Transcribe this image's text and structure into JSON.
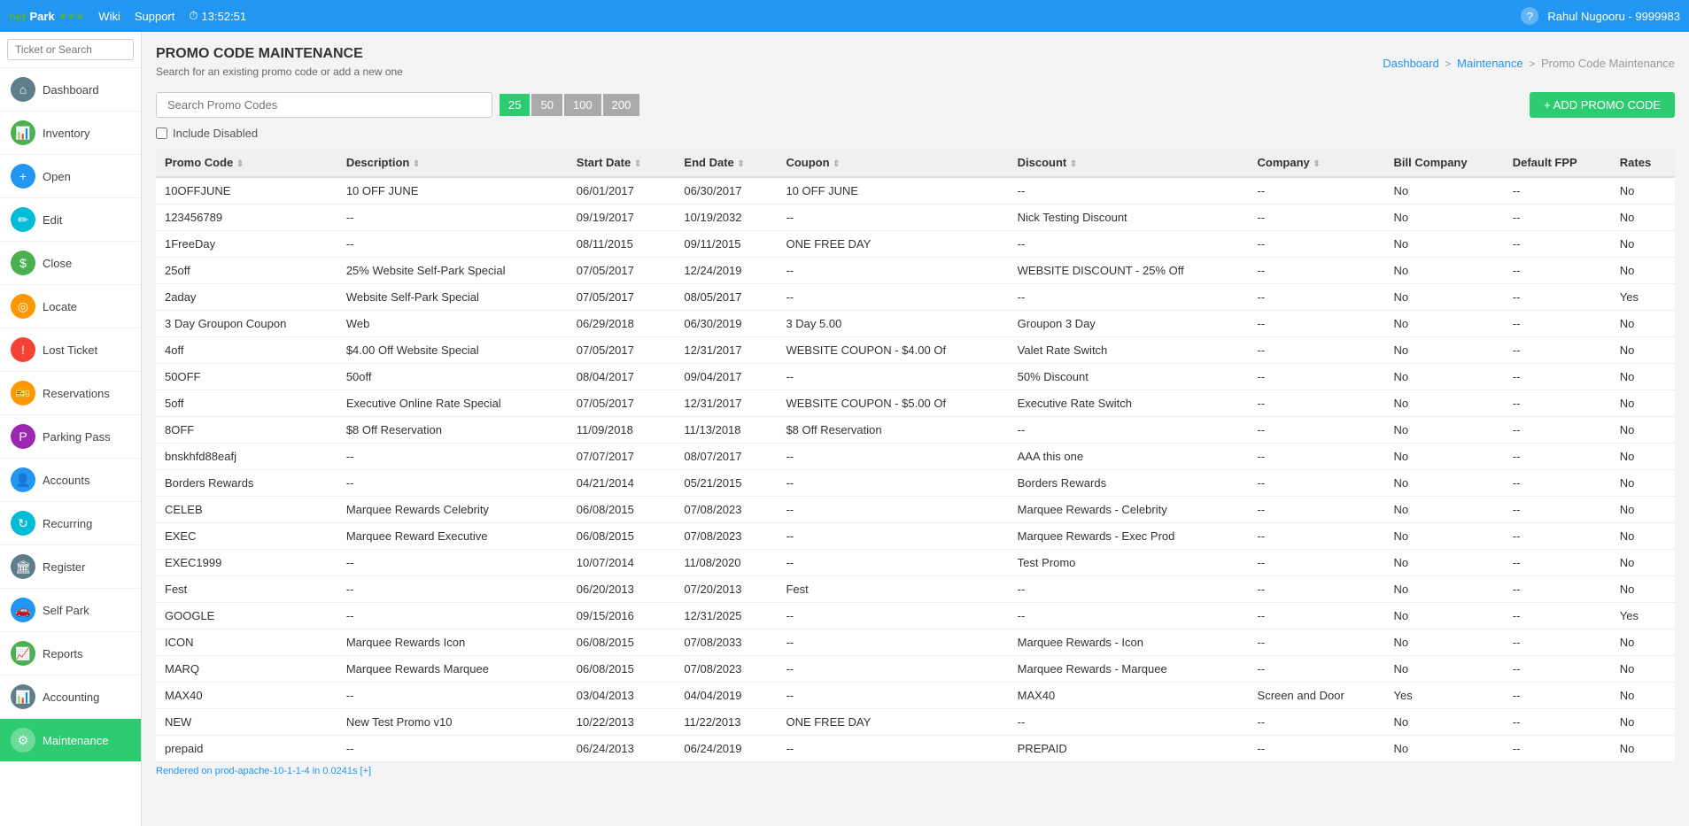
{
  "topbar": {
    "logo_net": "net",
    "logo_park": "Park",
    "wiki": "Wiki",
    "support": "Support",
    "clock": "13:52:51",
    "help": "?",
    "user": "Rahul Nugooru - 9999983"
  },
  "sidebar": {
    "search_placeholder": "Ticket or Search",
    "items": [
      {
        "id": "dashboard",
        "label": "Dashboard",
        "icon": "⌂",
        "icon_class": "icon-home",
        "active": false
      },
      {
        "id": "inventory",
        "label": "Inventory",
        "icon": "📊",
        "icon_class": "icon-chart",
        "active": false
      },
      {
        "id": "open",
        "label": "Open",
        "icon": "+",
        "icon_class": "icon-plus",
        "active": false
      },
      {
        "id": "edit",
        "label": "Edit",
        "icon": "✎",
        "icon_class": "icon-edit",
        "active": false
      },
      {
        "id": "close",
        "label": "Close",
        "icon": "$",
        "icon_class": "icon-dollar",
        "active": false
      },
      {
        "id": "locate",
        "label": "Locate",
        "icon": "◎",
        "icon_class": "icon-locate",
        "active": false
      },
      {
        "id": "lost-ticket",
        "label": "Lost Ticket",
        "icon": "!",
        "icon_class": "icon-warning",
        "active": false
      },
      {
        "id": "reservations",
        "label": "Reservations",
        "icon": "🎫",
        "icon_class": "icon-ticket",
        "active": false
      },
      {
        "id": "parking-pass",
        "label": "Parking Pass",
        "icon": "P",
        "icon_class": "icon-parking",
        "active": false
      },
      {
        "id": "accounts",
        "label": "Accounts",
        "icon": "👤",
        "icon_class": "icon-accounts",
        "active": false
      },
      {
        "id": "recurring",
        "label": "Recurring",
        "icon": "↻",
        "icon_class": "icon-recurring",
        "active": false
      },
      {
        "id": "register",
        "label": "Register",
        "icon": "🏛",
        "icon_class": "icon-register",
        "active": false
      },
      {
        "id": "self-park",
        "label": "Self Park",
        "icon": "🚗",
        "icon_class": "icon-selfpark",
        "active": false
      },
      {
        "id": "reports",
        "label": "Reports",
        "icon": "📈",
        "icon_class": "icon-reports",
        "active": false
      },
      {
        "id": "accounting",
        "label": "Accounting",
        "icon": "📊",
        "icon_class": "icon-accounting",
        "active": false
      },
      {
        "id": "maintenance",
        "label": "Maintenance",
        "icon": "⚙",
        "icon_class": "icon-maintenance",
        "active": true
      }
    ]
  },
  "page": {
    "title": "PROMO CODE MAINTENANCE",
    "subtitle": "Search for an existing promo code or add a new one",
    "breadcrumb_dashboard": "Dashboard",
    "breadcrumb_maintenance": "Maintenance",
    "breadcrumb_current": "Promo Code Maintenance",
    "search_placeholder": "Search Promo Codes",
    "page_sizes": [
      "25",
      "50",
      "100",
      "200"
    ],
    "active_page_size": "25",
    "add_button": "+ ADD PROMO CODE",
    "include_disabled": "Include Disabled"
  },
  "table": {
    "columns": [
      "Promo Code",
      "Description",
      "Start Date",
      "End Date",
      "Coupon",
      "Discount",
      "Company",
      "Bill Company",
      "Default FPP",
      "Rates"
    ],
    "rows": [
      {
        "promo_code": "10OFFJUNE",
        "description": "10 OFF JUNE",
        "start_date": "06/01/2017",
        "end_date": "06/30/2017",
        "coupon": "10 OFF JUNE",
        "discount": "--",
        "company": "--",
        "bill_company": "No",
        "default_fpp": "--",
        "rates": "No"
      },
      {
        "promo_code": "123456789",
        "description": "--",
        "start_date": "09/19/2017",
        "end_date": "10/19/2032",
        "coupon": "--",
        "discount": "Nick Testing Discount",
        "company": "--",
        "bill_company": "No",
        "default_fpp": "--",
        "rates": "No"
      },
      {
        "promo_code": "1FreeDay",
        "description": "--",
        "start_date": "08/11/2015",
        "end_date": "09/11/2015",
        "coupon": "ONE FREE DAY",
        "discount": "--",
        "company": "--",
        "bill_company": "No",
        "default_fpp": "--",
        "rates": "No"
      },
      {
        "promo_code": "25off",
        "description": "25% Website Self-Park Special",
        "start_date": "07/05/2017",
        "end_date": "12/24/2019",
        "coupon": "--",
        "discount": "WEBSITE DISCOUNT - 25% Off",
        "company": "--",
        "bill_company": "No",
        "default_fpp": "--",
        "rates": "No"
      },
      {
        "promo_code": "2aday",
        "description": "Website Self-Park Special",
        "start_date": "07/05/2017",
        "end_date": "08/05/2017",
        "coupon": "--",
        "discount": "--",
        "company": "--",
        "bill_company": "No",
        "default_fpp": "--",
        "rates": "Yes"
      },
      {
        "promo_code": "3 Day Groupon Coupon",
        "description": "Web",
        "start_date": "06/29/2018",
        "end_date": "06/30/2019",
        "coupon": "3 Day 5.00",
        "discount": "Groupon 3 Day",
        "company": "--",
        "bill_company": "No",
        "default_fpp": "--",
        "rates": "No"
      },
      {
        "promo_code": "4off",
        "description": "$4.00 Off Website Special",
        "start_date": "07/05/2017",
        "end_date": "12/31/2017",
        "coupon": "WEBSITE COUPON - $4.00 Of",
        "discount": "Valet Rate Switch",
        "company": "--",
        "bill_company": "No",
        "default_fpp": "--",
        "rates": "No"
      },
      {
        "promo_code": "50OFF",
        "description": "50off",
        "start_date": "08/04/2017",
        "end_date": "09/04/2017",
        "coupon": "--",
        "discount": "50% Discount",
        "company": "--",
        "bill_company": "No",
        "default_fpp": "--",
        "rates": "No"
      },
      {
        "promo_code": "5off",
        "description": "Executive Online Rate Special",
        "start_date": "07/05/2017",
        "end_date": "12/31/2017",
        "coupon": "WEBSITE COUPON - $5.00 Of",
        "discount": "Executive Rate Switch",
        "company": "--",
        "bill_company": "No",
        "default_fpp": "--",
        "rates": "No"
      },
      {
        "promo_code": "8OFF",
        "description": "$8 Off Reservation",
        "start_date": "11/09/2018",
        "end_date": "11/13/2018",
        "coupon": "$8 Off Reservation",
        "discount": "--",
        "company": "--",
        "bill_company": "No",
        "default_fpp": "--",
        "rates": "No"
      },
      {
        "promo_code": "bnskhfd88eafj",
        "description": "--",
        "start_date": "07/07/2017",
        "end_date": "08/07/2017",
        "coupon": "--",
        "discount": "AAA this one",
        "company": "--",
        "bill_company": "No",
        "default_fpp": "--",
        "rates": "No"
      },
      {
        "promo_code": "Borders Rewards",
        "description": "--",
        "start_date": "04/21/2014",
        "end_date": "05/21/2015",
        "coupon": "--",
        "discount": "Borders Rewards",
        "company": "--",
        "bill_company": "No",
        "default_fpp": "--",
        "rates": "No"
      },
      {
        "promo_code": "CELEB",
        "description": "Marquee Rewards Celebrity",
        "start_date": "06/08/2015",
        "end_date": "07/08/2023",
        "coupon": "--",
        "discount": "Marquee Rewards - Celebrity",
        "company": "--",
        "bill_company": "No",
        "default_fpp": "--",
        "rates": "No"
      },
      {
        "promo_code": "EXEC",
        "description": "Marquee Reward Executive",
        "start_date": "06/08/2015",
        "end_date": "07/08/2023",
        "coupon": "--",
        "discount": "Marquee Rewards - Exec Prod",
        "company": "--",
        "bill_company": "No",
        "default_fpp": "--",
        "rates": "No"
      },
      {
        "promo_code": "EXEC1999",
        "description": "--",
        "start_date": "10/07/2014",
        "end_date": "11/08/2020",
        "coupon": "--",
        "discount": "Test Promo",
        "company": "--",
        "bill_company": "No",
        "default_fpp": "--",
        "rates": "No"
      },
      {
        "promo_code": "Fest",
        "description": "--",
        "start_date": "06/20/2013",
        "end_date": "07/20/2013",
        "coupon": "Fest",
        "discount": "--",
        "company": "--",
        "bill_company": "No",
        "default_fpp": "--",
        "rates": "No"
      },
      {
        "promo_code": "GOOGLE",
        "description": "--",
        "start_date": "09/15/2016",
        "end_date": "12/31/2025",
        "coupon": "--",
        "discount": "--",
        "company": "--",
        "bill_company": "No",
        "default_fpp": "--",
        "rates": "Yes"
      },
      {
        "promo_code": "ICON",
        "description": "Marquee Rewards Icon",
        "start_date": "06/08/2015",
        "end_date": "07/08/2033",
        "coupon": "--",
        "discount": "Marquee Rewards - Icon",
        "company": "--",
        "bill_company": "No",
        "default_fpp": "--",
        "rates": "No"
      },
      {
        "promo_code": "MARQ",
        "description": "Marquee Rewards Marquee",
        "start_date": "06/08/2015",
        "end_date": "07/08/2023",
        "coupon": "--",
        "discount": "Marquee Rewards - Marquee",
        "company": "--",
        "bill_company": "No",
        "default_fpp": "--",
        "rates": "No"
      },
      {
        "promo_code": "MAX40",
        "description": "--",
        "start_date": "03/04/2013",
        "end_date": "04/04/2019",
        "coupon": "--",
        "discount": "MAX40",
        "company": "Screen and Door",
        "bill_company": "Yes",
        "default_fpp": "--",
        "rates": "No"
      },
      {
        "promo_code": "NEW",
        "description": "New Test Promo v10",
        "start_date": "10/22/2013",
        "end_date": "11/22/2013",
        "coupon": "ONE FREE DAY",
        "discount": "--",
        "company": "--",
        "bill_company": "No",
        "default_fpp": "--",
        "rates": "No"
      },
      {
        "promo_code": "prepaid",
        "description": "--",
        "start_date": "06/24/2013",
        "end_date": "06/24/2019",
        "coupon": "--",
        "discount": "PREPAID",
        "company": "--",
        "bill_company": "No",
        "default_fpp": "--",
        "rates": "No"
      }
    ],
    "footer_note": "Rendered on prod-apache-10-1-1-4 in 0.0241s [+]"
  }
}
